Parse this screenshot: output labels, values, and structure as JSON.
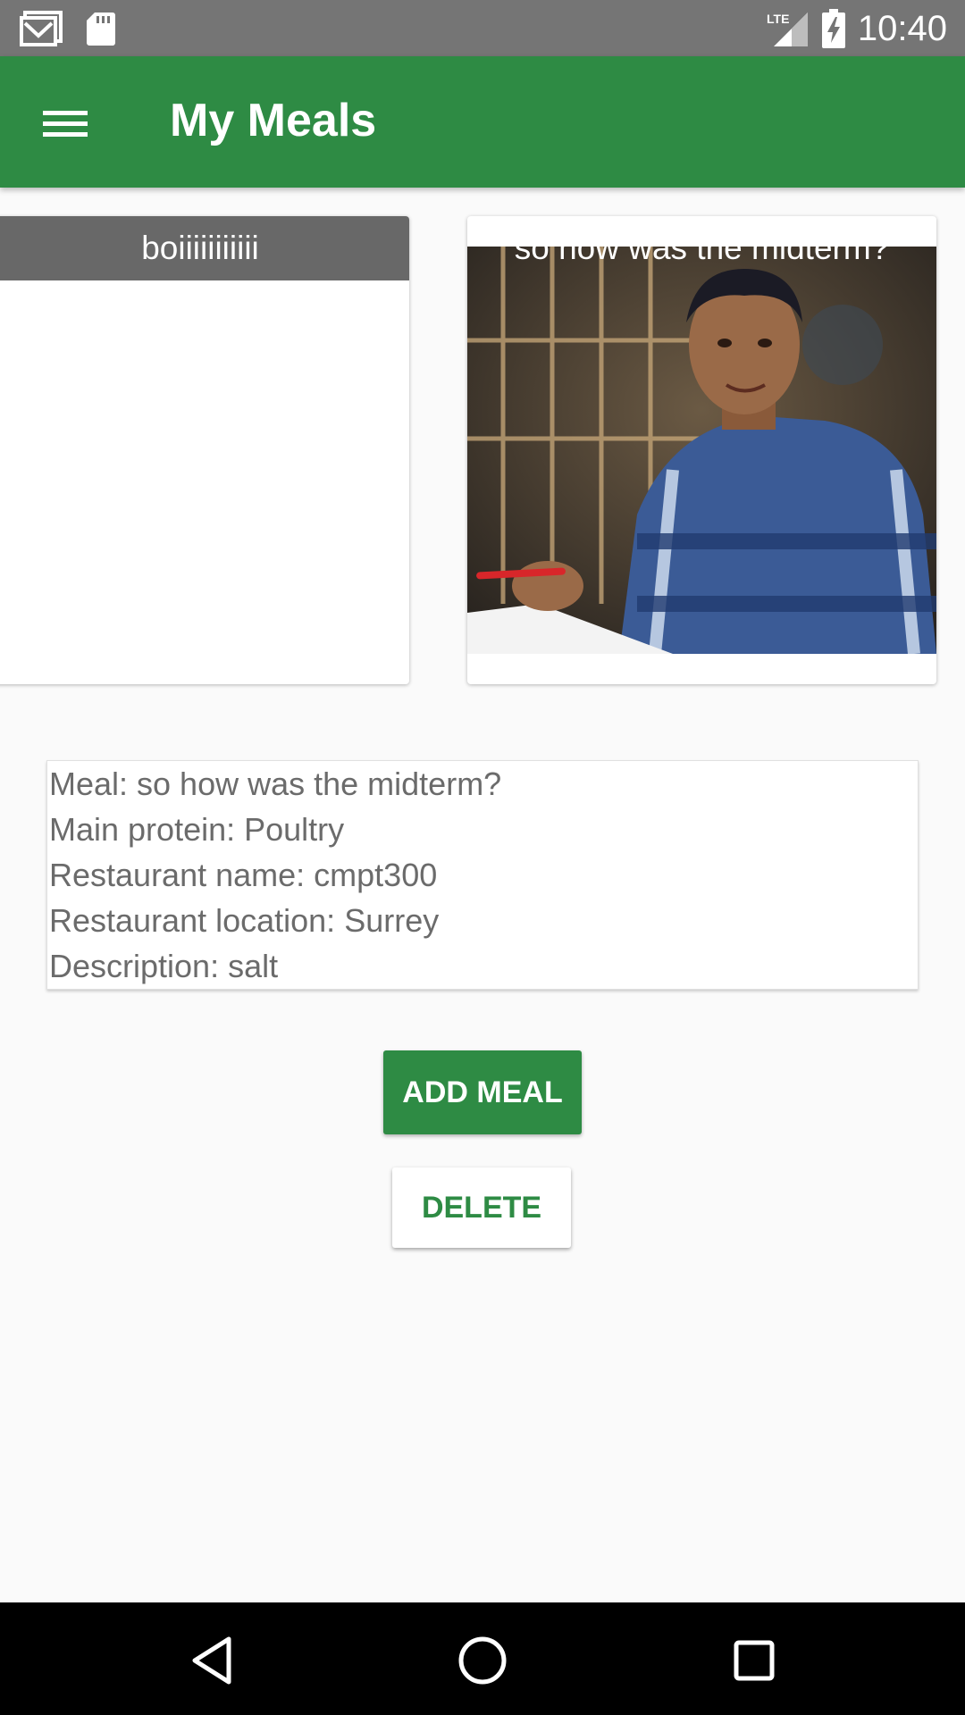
{
  "status_bar": {
    "time": "10:40",
    "network": "LTE"
  },
  "app_bar": {
    "title": "My Meals"
  },
  "cards": [
    {
      "title": "boiiiiiiiiiii"
    },
    {
      "title": "so how was the midterm?"
    }
  ],
  "details": {
    "lines": [
      "Meal: so how was the midterm?",
      "Main protein: Poultry",
      "Restaurant name: cmpt300",
      "Restaurant location: Surrey",
      "Description: salt"
    ]
  },
  "buttons": {
    "add_meal": "ADD MEAL",
    "delete": "DELETE"
  },
  "colors": {
    "primary": "#2e8b44",
    "status_bar": "#757575",
    "nav_bar": "#000000"
  }
}
